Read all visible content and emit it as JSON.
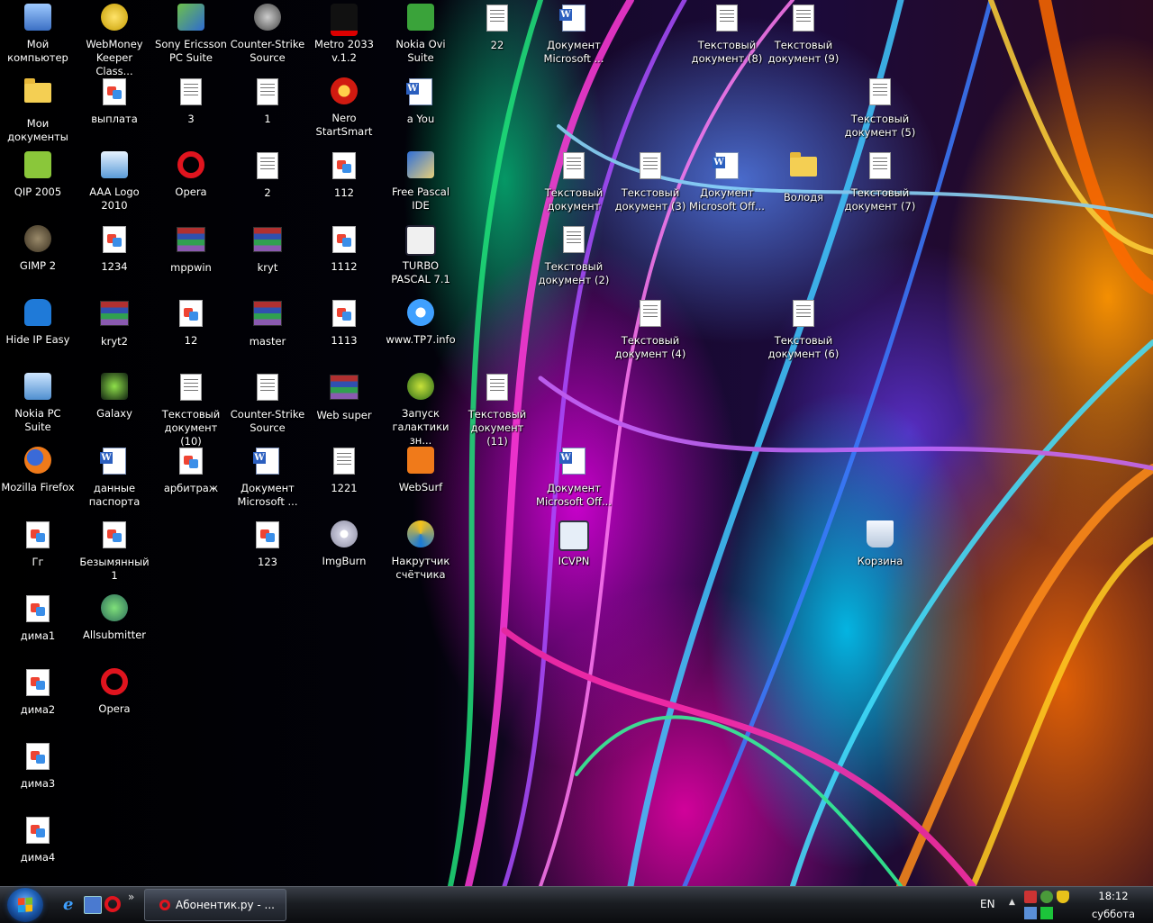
{
  "desktop": {
    "icons": [
      {
        "label": "Мой\nкомпьютер",
        "icon": "computer-icon"
      },
      {
        "label": "WebMoney\nKeeper Class...",
        "icon": "webmoney-icon"
      },
      {
        "label": "Sony Ericsson\nPC Suite",
        "icon": "sony-ericsson-icon"
      },
      {
        "label": "Counter-Strike\nSource",
        "icon": "counter-strike-icon"
      },
      {
        "label": "Metro 2033\nv.1.2",
        "icon": "metro-2033-icon"
      },
      {
        "label": "Nokia Ovi Suite",
        "icon": "nokia-ovi-icon"
      },
      {
        "label": "22",
        "icon": "text-document-icon"
      },
      {
        "label": "Документ\nMicrosoft ...",
        "icon": "word-document-icon"
      },
      {
        "label": "Текстовый\nдокумент (8)",
        "icon": "text-document-icon"
      },
      {
        "label": "Текстовый\nдокумент (9)",
        "icon": "text-document-icon"
      },
      {
        "label": "Мои\nдокументы",
        "icon": "my-documents-icon"
      },
      {
        "label": "выплата",
        "icon": "image-file-icon"
      },
      {
        "label": "3",
        "icon": "text-document-icon"
      },
      {
        "label": "1",
        "icon": "text-document-icon"
      },
      {
        "label": "Nero\nStartSmart",
        "icon": "nero-icon"
      },
      {
        "label": "a You",
        "icon": "word-document-icon"
      },
      {
        "label": "Текстовый\nдокумент (5)",
        "icon": "text-document-icon"
      },
      {
        "label": "QIP 2005",
        "icon": "qip-icon"
      },
      {
        "label": "AAA Logo 2010",
        "icon": "aaa-logo-icon"
      },
      {
        "label": "Opera",
        "icon": "opera-icon"
      },
      {
        "label": "2",
        "icon": "text-document-icon"
      },
      {
        "label": "112",
        "icon": "image-file-icon"
      },
      {
        "label": "Free Pascal IDE",
        "icon": "free-pascal-icon"
      },
      {
        "label": "Текстовый\nдокумент",
        "icon": "text-document-icon"
      },
      {
        "label": "Текстовый\nдокумент (3)",
        "icon": "text-document-icon"
      },
      {
        "label": "Документ\nMicrosoft Off...",
        "icon": "word-document-icon"
      },
      {
        "label": "Володя",
        "icon": "folder-icon"
      },
      {
        "label": "Текстовый\nдокумент (7)",
        "icon": "text-document-icon"
      },
      {
        "label": "GIMP 2",
        "icon": "gimp-icon"
      },
      {
        "label": "1234",
        "icon": "image-file-icon"
      },
      {
        "label": "mppwin",
        "icon": "winrar-icon"
      },
      {
        "label": "kryt",
        "icon": "winrar-icon"
      },
      {
        "label": "1112",
        "icon": "image-file-icon"
      },
      {
        "label": "TURBO\nPASCAL 7.1",
        "icon": "turbo-pascal-icon"
      },
      {
        "label": "Текстовый\nдокумент (2)",
        "icon": "text-document-icon"
      },
      {
        "label": "Hide IP Easy",
        "icon": "hide-ip-icon"
      },
      {
        "label": "kryt2",
        "icon": "winrar-icon"
      },
      {
        "label": "12",
        "icon": "image-file-icon"
      },
      {
        "label": "master",
        "icon": "winrar-icon"
      },
      {
        "label": "1113",
        "icon": "image-file-icon"
      },
      {
        "label": "www.TP7.info",
        "icon": "internet-explorer-icon"
      },
      {
        "label": "Текстовый\nдокумент (4)",
        "icon": "text-document-icon"
      },
      {
        "label": "Текстовый\nдокумент (6)",
        "icon": "text-document-icon"
      },
      {
        "label": "Nokia PC Suite",
        "icon": "nokia-pc-suite-icon"
      },
      {
        "label": "Galaxy",
        "icon": "galaxy-icon"
      },
      {
        "label": "Текстовый\nдокумент (10)",
        "icon": "text-document-icon"
      },
      {
        "label": "Counter-Strike\nSource",
        "icon": "cs-config-icon"
      },
      {
        "label": "Web super",
        "icon": "winrar-icon"
      },
      {
        "label": "Запуск\nгалактики зн...",
        "icon": "galaxy-launch-icon"
      },
      {
        "label": "Текстовый\nдокумент (11)",
        "icon": "text-document-icon"
      },
      {
        "label": "Mozilla Firefox",
        "icon": "firefox-icon"
      },
      {
        "label": "данные\nпаспорта",
        "icon": "word-document-icon"
      },
      {
        "label": "арбитраж",
        "icon": "image-file-icon"
      },
      {
        "label": "Документ\nMicrosoft ...",
        "icon": "word-document-icon"
      },
      {
        "label": "1221",
        "icon": "cs-config-icon"
      },
      {
        "label": "WebSurf",
        "icon": "websurf-icon"
      },
      {
        "label": "Документ\nMicrosoft Off...",
        "icon": "word-document-icon"
      },
      {
        "label": "Гг",
        "icon": "image-file-icon"
      },
      {
        "label": "Безымянный1",
        "icon": "image-file-icon"
      },
      {
        "label": "123",
        "icon": "image-file-icon"
      },
      {
        "label": "ImgBurn",
        "icon": "imgburn-icon"
      },
      {
        "label": "Накрутчик\nсчётчика",
        "icon": "counter-tool-icon"
      },
      {
        "label": "ICVPN",
        "icon": "icvpn-icon"
      },
      {
        "label": "Корзина",
        "icon": "recycle-bin-icon"
      },
      {
        "label": "дима1",
        "icon": "image-file-icon"
      },
      {
        "label": "Allsubmitter",
        "icon": "allsubmitter-icon"
      },
      {
        "label": "дима2",
        "icon": "image-file-icon"
      },
      {
        "label": "Opera",
        "icon": "opera-icon"
      },
      {
        "label": "дима3",
        "icon": "image-file-icon"
      },
      {
        "label": "дима4",
        "icon": "image-file-icon"
      }
    ]
  },
  "taskbar": {
    "task_label": "Абонентик.ру - ...",
    "language": "EN",
    "more_glyph": "»",
    "tray_arrow": "▲",
    "time": "18:12",
    "day": "суббота"
  },
  "colors": {
    "opera_red": "#e0141e",
    "start_blue": "#1e5fb4",
    "taskbar_dark": "#1a1d22"
  }
}
